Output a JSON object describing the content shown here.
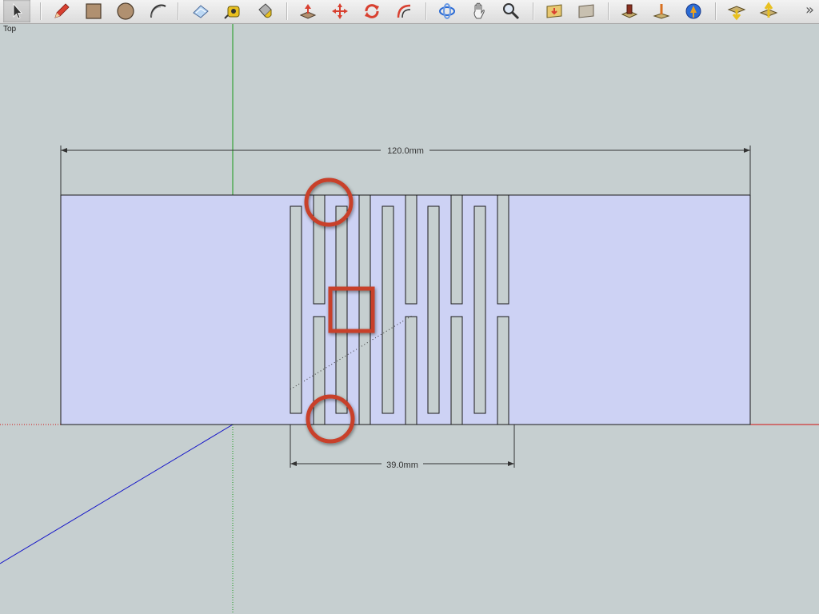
{
  "toolbar": {
    "tools": [
      {
        "name": "select-tool",
        "icon": "arrow-cursor-icon"
      },
      {
        "name": "pencil-tool",
        "icon": "pencil-icon"
      },
      {
        "name": "rectangle-tool",
        "icon": "rectangle-icon"
      },
      {
        "name": "circle-tool",
        "icon": "circle-icon"
      },
      {
        "name": "arc-tool",
        "icon": "arc-icon"
      },
      {
        "name": "eraser-tool",
        "icon": "eraser-icon"
      },
      {
        "name": "tape-measure-tool",
        "icon": "tape-measure-icon"
      },
      {
        "name": "paint-bucket-tool",
        "icon": "paint-bucket-icon"
      },
      {
        "name": "push-pull-tool",
        "icon": "push-pull-icon"
      },
      {
        "name": "move-tool",
        "icon": "move-icon"
      },
      {
        "name": "rotate-tool",
        "icon": "rotate-icon"
      },
      {
        "name": "offset-tool",
        "icon": "offset-icon"
      },
      {
        "name": "orbit-tool",
        "icon": "orbit-icon"
      },
      {
        "name": "pan-tool",
        "icon": "hand-icon"
      },
      {
        "name": "zoom-tool",
        "icon": "magnifier-icon"
      },
      {
        "name": "position-camera-tool",
        "icon": "camera-icon"
      },
      {
        "name": "walk-tool",
        "icon": "walk-icon"
      },
      {
        "name": "get-models-tool",
        "icon": "warehouse-icon"
      },
      {
        "name": "sandbox-tool",
        "icon": "sandbox-icon"
      },
      {
        "name": "google-earth-tool",
        "icon": "globe-icon"
      },
      {
        "name": "get-components-tool",
        "icon": "download-component-icon"
      },
      {
        "name": "share-component-tool",
        "icon": "upload-component-icon"
      }
    ],
    "overflow_label": "»"
  },
  "viewport": {
    "view_name": "Top",
    "dimensions": [
      {
        "label": "120.0mm"
      },
      {
        "label": "39.0mm"
      }
    ]
  },
  "colors": {
    "background": "#c6cfd0",
    "face_fill": "#cdd2f4",
    "edge": "#1a1a1a",
    "axis_red": "#d21010",
    "axis_green": "#1a9a1a",
    "axis_blue": "#1515c8",
    "highlight": "#c8402a"
  }
}
